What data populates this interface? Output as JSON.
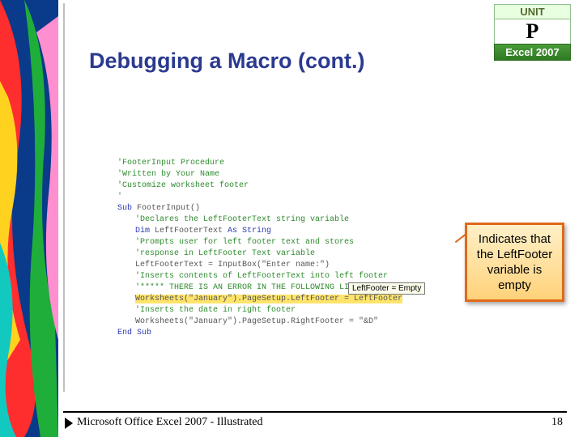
{
  "unit": {
    "label": "UNIT",
    "letter": "P",
    "product": "Excel 2007"
  },
  "title": "Debugging a Macro (cont.)",
  "code": {
    "c1": "'FooterInput Procedure",
    "c2": "'Written by Your Name",
    "c3": "'Customize worksheet footer",
    "c4": "'",
    "sub": "Sub ",
    "name": "FooterInput()",
    "d1": "'Declares the LeftFooterText string variable",
    "dim": "Dim ",
    "var": "LeftFooterText ",
    "as": "As String",
    "d2": "'Prompts user for left footer text and stores",
    "d3": "'response in LeftFooter Text variable",
    "l1": "LeftFooterText = InputBox(\"Enter name:\")",
    "d4": "'Inserts contents of LeftFooterText into left footer",
    "d5": "'***** THERE IS AN ERROR IN THE FOLLOWING LINE *****",
    "hl": "Worksheets(\"January\").PageSetup.LeftFooter = LeftFooter",
    "d6": "'Inserts the date in right footer",
    "l2": "Worksheets(\"January\").PageSetup.RightFooter = \"&D\"",
    "end": "End Sub"
  },
  "tooltip": "LeftFooter = Empty",
  "callout": "Indicates that the LeftFooter variable is empty",
  "footer": {
    "left": "Microsoft Office Excel 2007 - Illustrated",
    "page": "18"
  }
}
